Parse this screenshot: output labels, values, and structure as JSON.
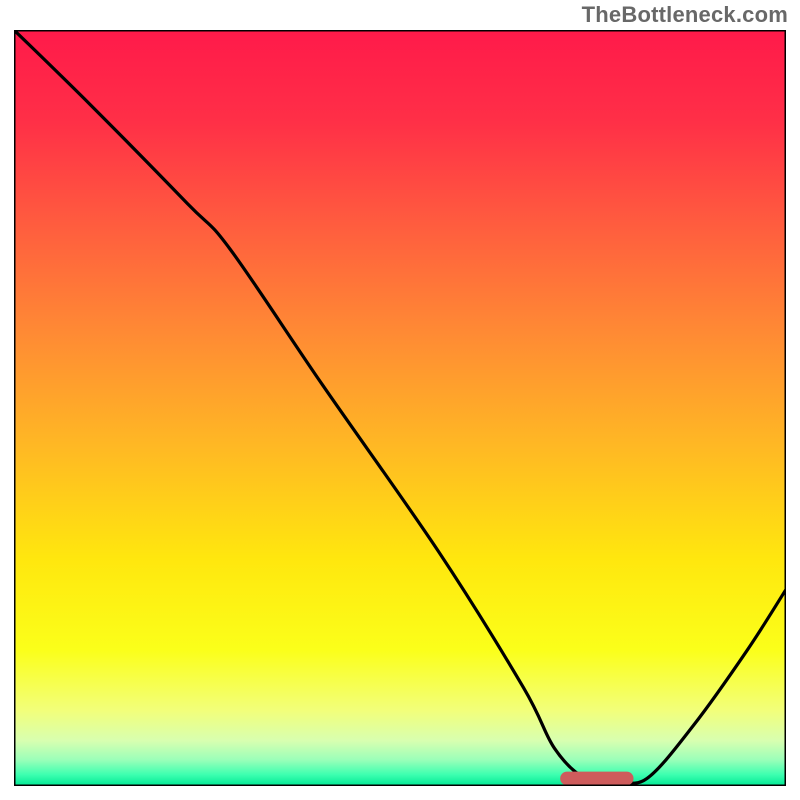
{
  "watermark": "TheBottleneck.com",
  "chart_data": {
    "type": "line",
    "title": "",
    "xlabel": "",
    "ylabel": "",
    "xlim": [
      0,
      100
    ],
    "ylim": [
      0,
      100
    ],
    "grid": false,
    "legend": null,
    "gradient_stops": [
      {
        "offset": 0.0,
        "color": "#ff1a4a"
      },
      {
        "offset": 0.12,
        "color": "#ff2f47"
      },
      {
        "offset": 0.25,
        "color": "#ff5a3f"
      },
      {
        "offset": 0.4,
        "color": "#ff8a34"
      },
      {
        "offset": 0.55,
        "color": "#ffb824"
      },
      {
        "offset": 0.7,
        "color": "#ffe70e"
      },
      {
        "offset": 0.82,
        "color": "#fbff1a"
      },
      {
        "offset": 0.9,
        "color": "#f2ff7a"
      },
      {
        "offset": 0.94,
        "color": "#d8ffb0"
      },
      {
        "offset": 0.965,
        "color": "#9cffb9"
      },
      {
        "offset": 0.985,
        "color": "#3dffb0"
      },
      {
        "offset": 1.0,
        "color": "#00e893"
      }
    ],
    "series": [
      {
        "name": "bottleneck-curve",
        "stroke": "#000000",
        "x": [
          0.0,
          10.0,
          22.5,
          28.0,
          40.0,
          55.0,
          66.0,
          70.0,
          74.0,
          78.0,
          82.0,
          88.0,
          95.0,
          100.0
        ],
        "y": [
          100.0,
          90.0,
          77.0,
          71.0,
          53.0,
          31.0,
          13.0,
          5.0,
          1.0,
          0.7,
          1.0,
          8.0,
          18.0,
          26.0
        ]
      }
    ],
    "marker": {
      "name": "optimal-marker",
      "color": "#ce5c5c",
      "x_center": 75.5,
      "y_center": 1.0,
      "width": 9.5,
      "height": 1.8,
      "rx": 0.9
    }
  }
}
